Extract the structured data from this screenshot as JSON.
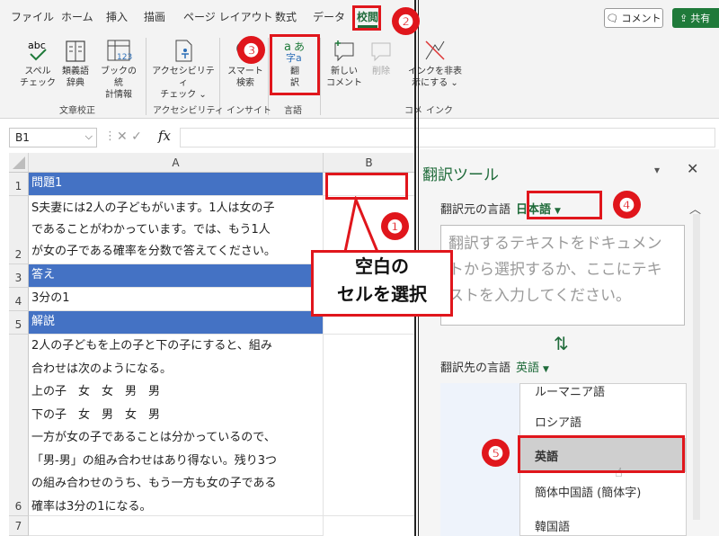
{
  "ribbon_tabs": [
    "ファイル",
    "ホーム",
    "挿入",
    "描画",
    "ページ レイアウト",
    "数式",
    "データ",
    "校閲"
  ],
  "comment_button": "コメント",
  "share_button": "共有",
  "ribbon": {
    "spell": "スペル\nチェック",
    "thesaurus": "類義語\n辞典",
    "workbook_stats": "ブックの統\n計情報",
    "accessibility": "アクセシビリティ\nチェック ⌄",
    "smart_lookup": "スマート\n検索",
    "translate": "翻\n訳",
    "new_comment": "新しい\nコメント",
    "delete": "削除",
    "ink_hide": "インクを非表\n示にする ⌄",
    "groups": {
      "proofing": "文章校正",
      "accessibility": "アクセシビリティ",
      "insights": "インサイト",
      "language": "言語",
      "comments": "コメ",
      "ink": "インク"
    }
  },
  "name_box": "B1",
  "formula_icons": "✕  ✓",
  "fx": "fx",
  "columns": [
    "A",
    "B"
  ],
  "rows": [
    {
      "num": "1",
      "a": "問題1",
      "highlight": true
    },
    {
      "num": "2",
      "a": "S夫妻には2人の子どもがいます。1人は女の子\nであることがわかっています。では、もう1人\nが女の子である確率を分数で答えてください。",
      "highlight": false
    },
    {
      "num": "3",
      "a": "答え",
      "highlight": true
    },
    {
      "num": "4",
      "a": "3分の1",
      "highlight": false
    },
    {
      "num": "5",
      "a": "解説",
      "highlight": true
    },
    {
      "num": "6",
      "a": "2人の子どもを上の子と下の子にすると、組み\n合わせは次のようになる。\n上の子　女　女　男　男\n下の子　女　男　女　男\n一方が女の子であることは分かっているので、\n「男-男」の組み合わせはあり得ない。残り3つ\nの組み合わせのうち、もう一方も女の子である\n確率は3分の1になる。",
      "highlight": false
    },
    {
      "num": "7",
      "a": "",
      "highlight": false
    }
  ],
  "translator": {
    "title": "翻訳ツール",
    "source_label": "翻訳元の言語",
    "source_lang": "日本語",
    "placeholder": "翻訳するテキストをドキュメントから選択するか、ここにテキストを入力してください。",
    "target_label": "翻訳先の言語",
    "target_lang": "英語",
    "options": [
      "ルーマニア語",
      "ロシア語",
      "英語",
      "簡体中国語 (簡体字)",
      "韓国語"
    ],
    "selected_option": "英語"
  },
  "callout": "空白の\nセルを選択",
  "steps": [
    "❶",
    "❷",
    "❸",
    "❹",
    "❺"
  ]
}
